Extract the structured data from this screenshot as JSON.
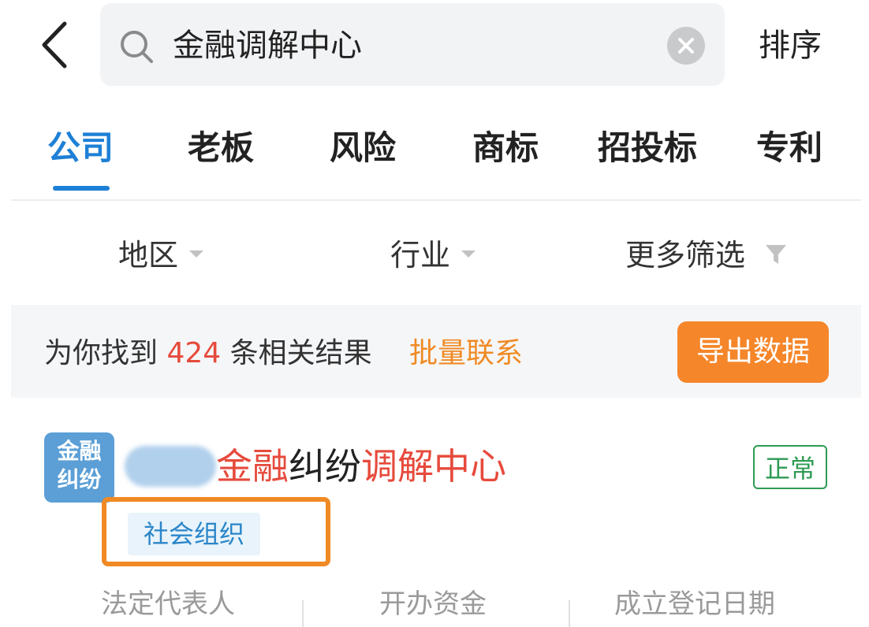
{
  "search": {
    "query": "金融调解中心",
    "sort_label": "排序"
  },
  "tabs": [
    {
      "label": "公司",
      "active": true
    },
    {
      "label": "老板",
      "active": false
    },
    {
      "label": "风险",
      "active": false
    },
    {
      "label": "商标",
      "active": false
    },
    {
      "label": "招投标",
      "active": false
    },
    {
      "label": "专利",
      "active": false
    }
  ],
  "filters": {
    "region": "地区",
    "industry": "行业",
    "more": "更多筛选"
  },
  "results": {
    "prefix": "为你找到",
    "count": "424",
    "suffix": "条相关结果",
    "batch_contact": "批量联系",
    "export_label": "导出数据"
  },
  "company": {
    "logo_line1": "金融",
    "logo_line2": "纠纷",
    "name_part1": "金融",
    "name_part2": "纠纷",
    "name_part3": "调解中心",
    "status": "正常",
    "type_tag": "社会组织",
    "info_labels": [
      "法定代表人",
      "开办资金",
      "成立登记日期"
    ]
  },
  "colors": {
    "accent_blue": "#1e80d6",
    "highlight_red": "#e64a3c",
    "orange": "#f5862a",
    "status_green": "#2e9b53"
  }
}
